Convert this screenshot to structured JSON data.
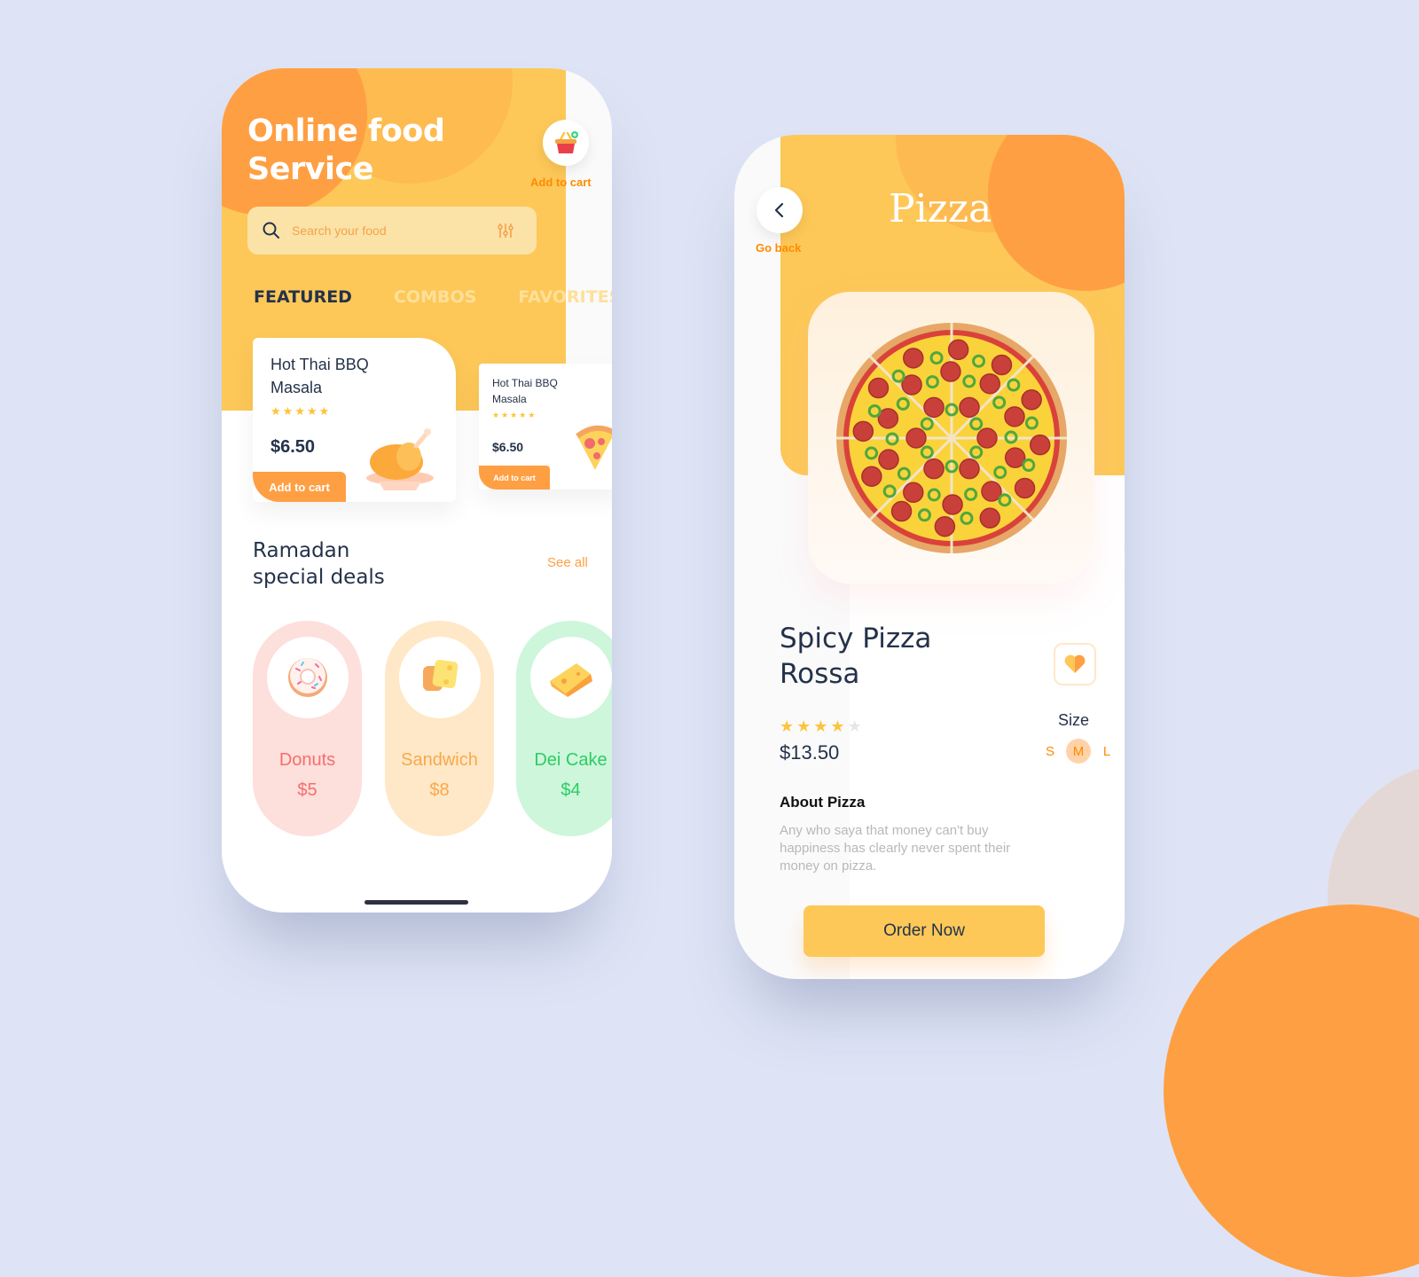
{
  "colors": {
    "background": "#DEE4F5",
    "primary_yellow": "#FDC858",
    "accent_orange": "#FF9F43",
    "text_dark": "#24324A"
  },
  "home_screen": {
    "title_line1": "Online food",
    "title_line2": "Service",
    "cart_button_icon": "basket-icon",
    "cart_label": "Add to cart",
    "search": {
      "placeholder": "Search your food",
      "value": ""
    },
    "tabs": [
      {
        "label": "FEATURED",
        "active": true
      },
      {
        "label": "COMBOS",
        "active": false
      },
      {
        "label": "FAVORITES",
        "active": false
      }
    ],
    "featured": [
      {
        "name_line1": "Hot Thai BBQ",
        "name_line2": "Masala",
        "rating": 5,
        "price": "$6.50",
        "button": "Add to cart",
        "image": "roast-chicken-icon"
      },
      {
        "name_line1": "Hot Thai BBQ",
        "name_line2": "Masala",
        "rating": 5,
        "price": "$6.50",
        "button": "Add to cart",
        "image": "pizza-slice-icon"
      }
    ],
    "deals_title_line1": "Ramadan",
    "deals_title_line2": "special deals",
    "see_all": "See all",
    "deals": [
      {
        "name": "Donuts",
        "price": "$5",
        "bg": "#FDDFDB",
        "color": "#F66E6E",
        "image": "donut-icon"
      },
      {
        "name": "Sandwich",
        "price": "$8",
        "bg": "#FFE8C7",
        "color": "#F9A84C",
        "image": "sandwich-icon"
      },
      {
        "name": "Dei Cake",
        "price": "$4",
        "bg": "#CDF6DB",
        "color": "#2ECC63",
        "image": "cheese-icon"
      }
    ]
  },
  "detail_screen": {
    "back_label": "Go back",
    "category_title": "Pizza",
    "product_name_line1": "Spicy Pizza",
    "product_name_line2": "Rossa",
    "rating": 4,
    "rating_max": 5,
    "price": "$13.50",
    "size_label": "Size",
    "sizes": [
      "S",
      "M",
      "L"
    ],
    "selected_size": "M",
    "about_title": "About Pizza",
    "about_text": "Any who saya that money can't buy happiness has clearly never spent their money on pizza.",
    "order_button": "Order Now"
  }
}
